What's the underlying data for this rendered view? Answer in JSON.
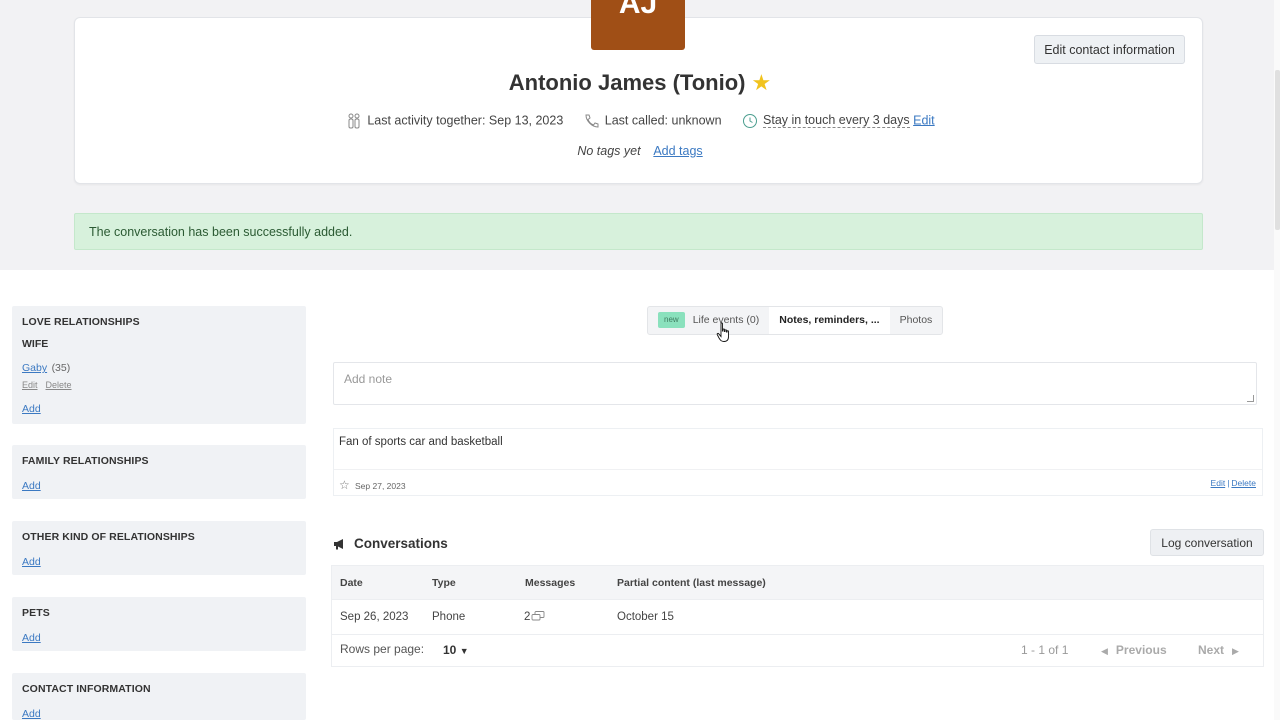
{
  "header": {
    "avatar_initials": "AJ",
    "avatar_color": "#a04f16",
    "edit_contact_label": "Edit contact information",
    "name": "Antonio James (Tonio)",
    "favorite_star": "★",
    "last_activity": "Last activity together: Sep 13, 2023",
    "last_called": "Last called: unknown",
    "stay_in_touch": "Stay in touch every 3 days",
    "stay_edit": "Edit",
    "no_tags": "No tags yet",
    "add_tags": "Add tags"
  },
  "alert": {
    "message": "The conversation has been successfully added.",
    "color": "#d7f1dc"
  },
  "sidebar": {
    "love": {
      "title": "LOVE RELATIONSHIPS",
      "sub": "WIFE",
      "person": "Gaby",
      "age": "(35)",
      "edit": "Edit",
      "delete": "Delete",
      "add": "Add"
    },
    "family": {
      "title": "FAMILY RELATIONSHIPS",
      "add": "Add"
    },
    "other": {
      "title": "OTHER KIND OF RELATIONSHIPS",
      "add": "Add"
    },
    "pets": {
      "title": "PETS",
      "add": "Add"
    },
    "contact": {
      "title": "CONTACT INFORMATION",
      "add": "Add"
    }
  },
  "tabs": {
    "new_badge": "new",
    "life_events": "Life events (0)",
    "notes": "Notes, reminders, ...",
    "photos": "Photos",
    "active": "notes"
  },
  "notes": {
    "placeholder": "Add note",
    "items": [
      {
        "text": "Fan of sports car and basketball",
        "date": "Sep 27, 2023",
        "edit": "Edit",
        "delete": "Delete"
      }
    ]
  },
  "conversations": {
    "title": "Conversations",
    "log_button": "Log conversation",
    "columns": [
      "Date",
      "Type",
      "Messages",
      "Partial content (last message)"
    ],
    "rows": [
      {
        "date": "Sep 26, 2023",
        "type": "Phone",
        "messages": "2",
        "content": "October 15"
      }
    ],
    "rows_per_page_label": "Rows per page:",
    "rows_per_page": "10",
    "page_info": "1 - 1 of 1",
    "previous": "Previous",
    "next": "Next"
  },
  "accent_link_color": "#3b79c2"
}
